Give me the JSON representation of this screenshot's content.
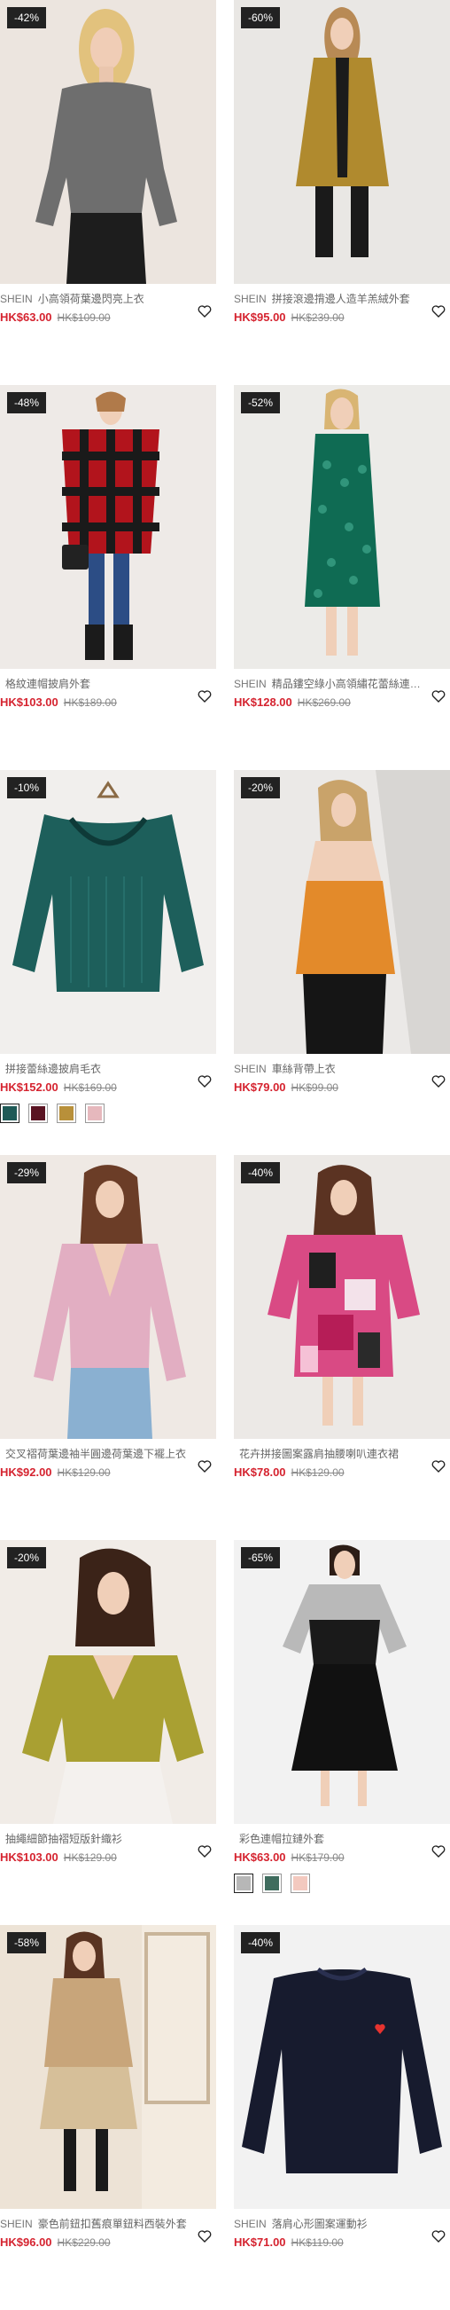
{
  "products": [
    {
      "badge": "-42%",
      "brand": "SHEIN",
      "title": "小高領荷葉邊閃亮上衣",
      "price": "HK$63.00",
      "original": "HK$109.00",
      "swatches": [],
      "image_icon": "model-grey-knit-top"
    },
    {
      "badge": "-60%",
      "brand": "SHEIN",
      "title": "拼接滾邊揹邊人造羊羔絨外套",
      "price": "HK$95.00",
      "original": "HK$239.00",
      "swatches": [],
      "image_icon": "model-mustard-coat"
    },
    {
      "badge": "-48%",
      "brand": "",
      "title": "格紋連帽披肩外套",
      "price": "HK$103.00",
      "original": "HK$189.00",
      "swatches": [],
      "image_icon": "model-plaid-cape"
    },
    {
      "badge": "-52%",
      "brand": "SHEIN",
      "title": "精品鏤空綠小高領繡花蕾絲連衣裙",
      "price": "HK$128.00",
      "original": "HK$269.00",
      "swatches": [],
      "image_icon": "model-green-lace-dress"
    },
    {
      "badge": "-10%",
      "brand": "",
      "title": "拼接蕾絲邊披肩毛衣",
      "price": "HK$152.00",
      "original": "HK$169.00",
      "swatches": [
        "#1f5a57",
        "#5a1422",
        "#b8903a",
        "#e6b8bd"
      ],
      "image_icon": "green-sweater"
    },
    {
      "badge": "-20%",
      "brand": "SHEIN",
      "title": "車絲背帶上衣",
      "price": "HK$79.00",
      "original": "HK$99.00",
      "swatches": [],
      "image_icon": "model-orange-cami"
    },
    {
      "badge": "-29%",
      "brand": "",
      "title": "交叉褶荷葉邊袖半圓邊荷葉邊下襬上衣",
      "price": "HK$92.00",
      "original": "HK$129.00",
      "swatches": [],
      "image_icon": "model-pink-blouse"
    },
    {
      "badge": "-40%",
      "brand": "",
      "title": "花卉拼接圖案露肩抽腰喇叭連衣裙",
      "price": "HK$78.00",
      "original": "HK$129.00",
      "swatches": [],
      "image_icon": "model-patchwork-dress"
    },
    {
      "badge": "-20%",
      "brand": "",
      "title": "抽繩細節抽褶短版針織衫",
      "price": "HK$103.00",
      "original": "HK$129.00",
      "swatches": [],
      "image_icon": "model-lime-knit"
    },
    {
      "badge": "-65%",
      "brand": "",
      "title": "彩色連帽拉鏈外套",
      "price": "HK$63.00",
      "original": "HK$179.00",
      "swatches": [
        "#b7b7b7",
        "#3f6c5e",
        "#f3c9bf"
      ],
      "image_icon": "model-colorblock-dress"
    },
    {
      "badge": "-58%",
      "brand": "SHEIN",
      "title": "豪色前鈕扣舊痕單鈕料西裝外套",
      "price": "HK$96.00",
      "original": "HK$229.00",
      "swatches": [],
      "image_icon": "model-camel-blazer"
    },
    {
      "badge": "-40%",
      "brand": "SHEIN",
      "title": "落肩心形圖案運動衫",
      "price": "HK$71.00",
      "original": "HK$119.00",
      "swatches": [],
      "image_icon": "navy-sweatshirt-heart"
    }
  ]
}
